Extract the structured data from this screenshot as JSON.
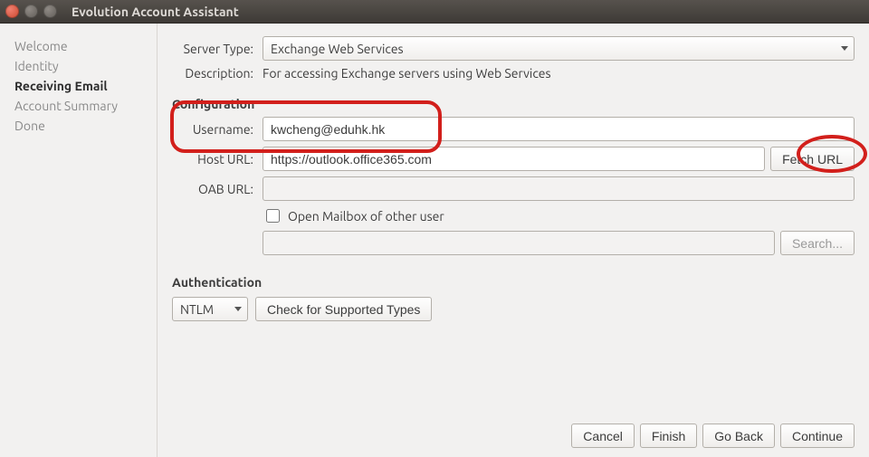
{
  "window": {
    "title": "Evolution Account Assistant"
  },
  "sidebar": {
    "items": [
      {
        "label": "Welcome"
      },
      {
        "label": "Identity"
      },
      {
        "label": "Receiving Email",
        "active": true
      },
      {
        "label": "Account Summary"
      },
      {
        "label": "Done"
      }
    ]
  },
  "form": {
    "server_type_label": "Server Type:",
    "server_type_value": "Exchange Web Services",
    "description_label": "Description:",
    "description_value": "For accessing Exchange servers using Web Services",
    "config_title": "Configuration",
    "username_label": "Username:",
    "username_value": "kwcheng@eduhk.hk",
    "host_label": "Host URL:",
    "host_value": "https://outlook.office365.com",
    "fetch_btn": "Fetch URL",
    "oab_label": "OAB URL:",
    "oab_value": "",
    "open_mailbox_label": "Open Mailbox of other user",
    "open_mailbox_checked": false,
    "other_mailbox_value": "",
    "search_btn": "Search...",
    "auth_title": "Authentication",
    "auth_method": "NTLM",
    "check_types_btn": "Check for Supported Types"
  },
  "footer": {
    "cancel": "Cancel",
    "finish": "Finish",
    "go_back": "Go Back",
    "continue": "Continue"
  }
}
